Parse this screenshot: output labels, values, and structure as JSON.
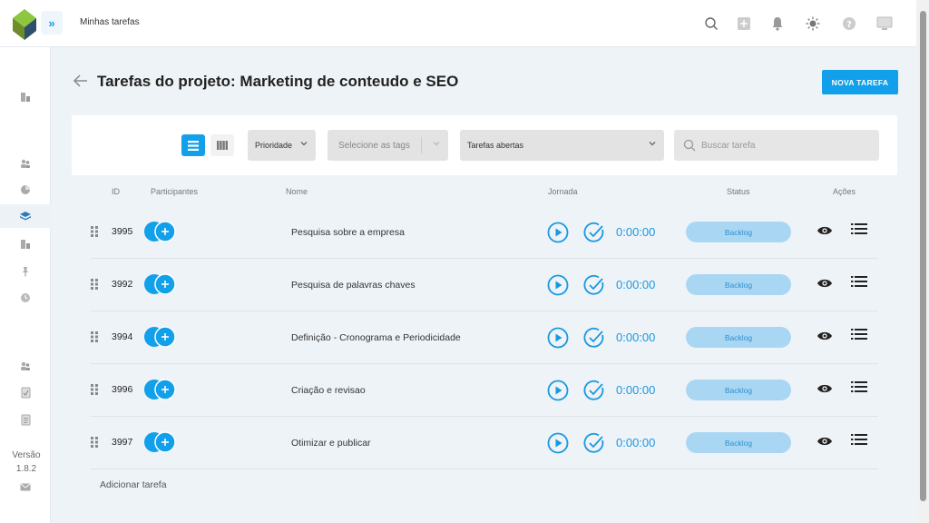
{
  "header": {
    "breadcrumb": "Minhas tarefas",
    "icons": [
      "search-icon",
      "plus-icon",
      "bell-icon",
      "sun-icon",
      "help-icon",
      "screen-icon"
    ]
  },
  "sidebar": {
    "icons": [
      "projects-icon",
      "users-icon",
      "chart-pie-icon",
      "layers-icon",
      "building-icon",
      "pin-icon",
      "clock-icon",
      "users-alt-icon",
      "checklist-icon",
      "document-icon"
    ],
    "version_label": "Versão",
    "version_number": "1.8.2",
    "mail_icon": "mail-icon"
  },
  "page": {
    "title": "Tarefas do projeto: Marketing de conteudo e SEO",
    "new_task_label": "NOVA TAREFA"
  },
  "filters": {
    "priority_label": "Prioridade",
    "tags_placeholder": "Selecione as tags",
    "status_filter": "Tarefas abertas",
    "search_placeholder": "Buscar tarefa"
  },
  "table": {
    "headers": {
      "id": "ID",
      "participants": "Participantes",
      "name": "Nome",
      "journey": "Jornada",
      "status": "Status",
      "actions": "Ações"
    },
    "rows": [
      {
        "id": "3995",
        "name": "Pesquisa sobre a empresa",
        "time": "0:00:00",
        "status": "Backlog"
      },
      {
        "id": "3992",
        "name": "Pesquisa de palavras chaves",
        "time": "0:00:00",
        "status": "Backlog"
      },
      {
        "id": "3994",
        "name": "Definição - Cronograma e Periodicidade",
        "time": "0:00:00",
        "status": "Backlog"
      },
      {
        "id": "3996",
        "name": "Criação e revisao",
        "time": "0:00:00",
        "status": "Backlog"
      },
      {
        "id": "3997",
        "name": "Otimizar e publicar",
        "time": "0:00:00",
        "status": "Backlog"
      }
    ],
    "add_task_label": "Adicionar tarefa"
  },
  "colors": {
    "accent": "#12a0ea",
    "status_bg": "#a9d7f3",
    "status_text": "#2f8fcf",
    "filter_bg": "#e3e3e3"
  }
}
